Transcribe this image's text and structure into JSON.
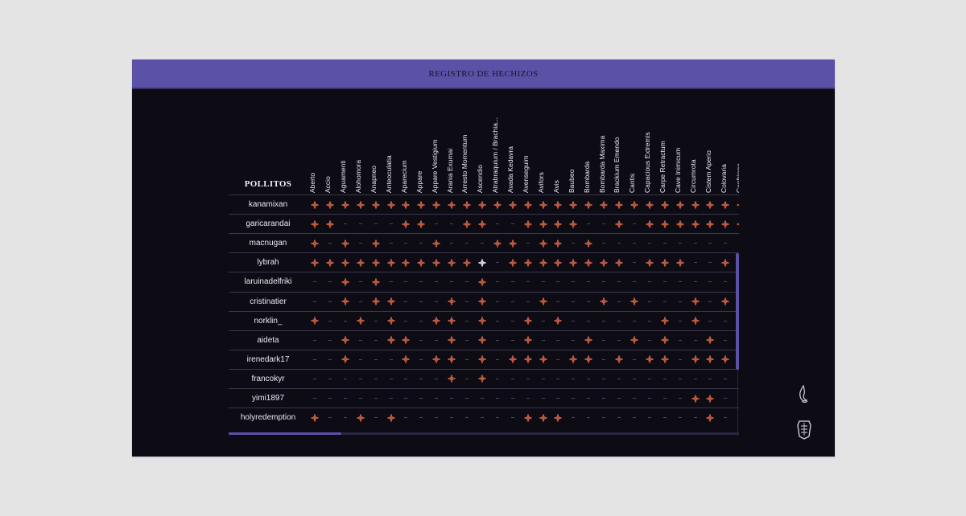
{
  "header": {
    "title": "REGISTRO DE HECHIZOS"
  },
  "table": {
    "corner_label": "POLLITOS",
    "columns": [
      "Aberto",
      "Accio",
      "Aguamenti",
      "Alohomora",
      "Anapneo",
      "Anteoculatia",
      "Aparecium",
      "Appare",
      "Appare Vestigium",
      "Arania Exumai",
      "Arresto Momentum",
      "Ascendio",
      "Atrabraquium / Brachia...",
      "Avada Kedavra",
      "Avenseguim",
      "Avifors",
      "Avis",
      "Baubeo",
      "Bombarda",
      "Bombarda Maxima",
      "Brackium Emendo",
      "Cantis",
      "Capacious Extremis",
      "Carpe Retractum",
      "Cave Inimicum",
      "Circumrota",
      "Cistem Aperio",
      "Colovaria",
      "Confringo"
    ],
    "rows": [
      {
        "name": "kanamixan",
        "cells": [
          1,
          1,
          1,
          1,
          1,
          1,
          1,
          1,
          1,
          1,
          1,
          1,
          1,
          1,
          1,
          1,
          1,
          1,
          1,
          1,
          1,
          1,
          1,
          1,
          1,
          1,
          1,
          1,
          1
        ]
      },
      {
        "name": "garicarandai",
        "cells": [
          1,
          1,
          0,
          0,
          0,
          0,
          1,
          1,
          0,
          0,
          1,
          1,
          0,
          0,
          1,
          1,
          1,
          1,
          0,
          0,
          1,
          0,
          1,
          1,
          1,
          1,
          1,
          1,
          1
        ]
      },
      {
        "name": "macnugan",
        "cells": [
          1,
          0,
          1,
          0,
          1,
          0,
          0,
          0,
          1,
          0,
          0,
          0,
          1,
          1,
          0,
          1,
          1,
          0,
          1,
          0,
          0,
          0,
          0,
          0,
          0,
          0,
          0,
          0,
          0
        ]
      },
      {
        "name": "lybrah",
        "cells": [
          1,
          1,
          1,
          1,
          1,
          1,
          1,
          1,
          1,
          1,
          1,
          2,
          0,
          1,
          1,
          1,
          1,
          1,
          1,
          1,
          1,
          0,
          1,
          1,
          1,
          0,
          0,
          1,
          1
        ]
      },
      {
        "name": "laruinadelfriki",
        "cells": [
          0,
          0,
          1,
          0,
          1,
          0,
          0,
          0,
          0,
          0,
          0,
          1,
          0,
          0,
          0,
          0,
          0,
          0,
          0,
          0,
          0,
          0,
          0,
          0,
          0,
          0,
          0,
          0,
          0
        ]
      },
      {
        "name": "cristinatier",
        "cells": [
          0,
          0,
          1,
          0,
          1,
          1,
          0,
          0,
          0,
          1,
          0,
          1,
          0,
          0,
          0,
          1,
          0,
          0,
          0,
          1,
          0,
          1,
          0,
          0,
          0,
          1,
          0,
          1,
          0
        ]
      },
      {
        "name": "norklin_",
        "cells": [
          1,
          0,
          0,
          1,
          0,
          1,
          0,
          0,
          1,
          1,
          0,
          1,
          0,
          0,
          1,
          0,
          1,
          0,
          0,
          0,
          0,
          0,
          0,
          1,
          0,
          1,
          0,
          0,
          0
        ]
      },
      {
        "name": "aideta",
        "cells": [
          0,
          0,
          1,
          0,
          0,
          1,
          1,
          0,
          0,
          1,
          0,
          1,
          0,
          0,
          1,
          0,
          0,
          0,
          1,
          0,
          0,
          1,
          0,
          1,
          0,
          0,
          1,
          0,
          0
        ]
      },
      {
        "name": "irenedark17",
        "cells": [
          0,
          0,
          1,
          0,
          0,
          0,
          1,
          0,
          1,
          1,
          0,
          1,
          0,
          1,
          1,
          1,
          0,
          1,
          1,
          0,
          1,
          0,
          1,
          1,
          0,
          1,
          1,
          1,
          0
        ]
      },
      {
        "name": "francokyr",
        "cells": [
          0,
          0,
          0,
          0,
          0,
          0,
          0,
          0,
          0,
          1,
          0,
          1,
          0,
          0,
          0,
          0,
          0,
          0,
          0,
          0,
          0,
          0,
          0,
          0,
          0,
          0,
          0,
          0,
          0
        ]
      },
      {
        "name": "yimi1897",
        "cells": [
          0,
          0,
          0,
          0,
          0,
          0,
          0,
          0,
          0,
          0,
          0,
          0,
          0,
          0,
          0,
          0,
          0,
          0,
          0,
          0,
          0,
          0,
          0,
          0,
          0,
          1,
          1,
          0,
          0
        ]
      },
      {
        "name": "holyredemption",
        "cells": [
          1,
          0,
          0,
          1,
          0,
          1,
          0,
          0,
          0,
          0,
          0,
          0,
          0,
          0,
          1,
          1,
          1,
          0,
          0,
          0,
          0,
          0,
          0,
          0,
          0,
          0,
          1,
          0,
          0
        ]
      }
    ]
  },
  "icons": {
    "flame": "flame-icon",
    "crest": "crest-icon",
    "spark": "sparkle-icon"
  },
  "colors": {
    "header": "#5b52a8",
    "background": "#0d0b14",
    "spark": "#b9573f",
    "highlight": "#cfcbe0"
  }
}
